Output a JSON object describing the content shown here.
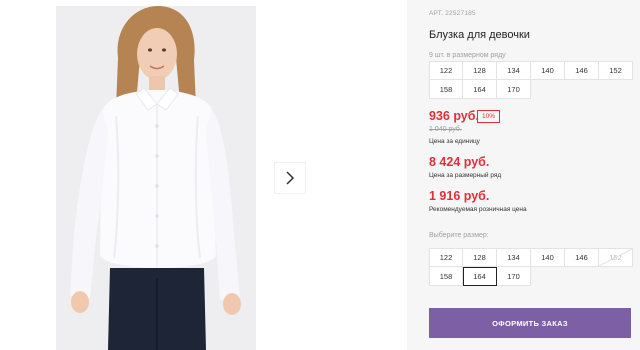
{
  "product": {
    "article": "АРТ. 22527185",
    "title": "Блузка для девочки",
    "pack_note": "9 шт. в размерном ряду",
    "size_range": [
      "122",
      "128",
      "134",
      "140",
      "146",
      "152",
      "158",
      "164",
      "170"
    ],
    "unit_price": "936 руб.",
    "discount": "10%",
    "old_price": "1 040 руб.",
    "unit_price_caption": "Цена за единицу",
    "range_price": "8 424 руб.",
    "range_price_caption": "Цена за размерный ряд",
    "retail_price": "1 916 руб.",
    "retail_price_caption": "Рекомендуемая розничная цена"
  },
  "size_picker": {
    "label": "Выберите размер:",
    "options": [
      {
        "size": "122",
        "state": "available"
      },
      {
        "size": "128",
        "state": "available"
      },
      {
        "size": "134",
        "state": "available"
      },
      {
        "size": "140",
        "state": "available"
      },
      {
        "size": "146",
        "state": "available"
      },
      {
        "size": "152",
        "state": "unavailable"
      },
      {
        "size": "158",
        "state": "available"
      },
      {
        "size": "164",
        "state": "selected"
      },
      {
        "size": "170",
        "state": "available"
      }
    ]
  },
  "actions": {
    "order_button": "ОФОРМИТЬ ЗАКАЗ"
  },
  "gallery": {
    "next_icon": "chevron-right-icon",
    "image": "product-photo"
  },
  "colors": {
    "accent_red": "#e22e3a",
    "order_button_bg": "#7d5fa6",
    "side_strip_bg": "#f6f6f6"
  }
}
